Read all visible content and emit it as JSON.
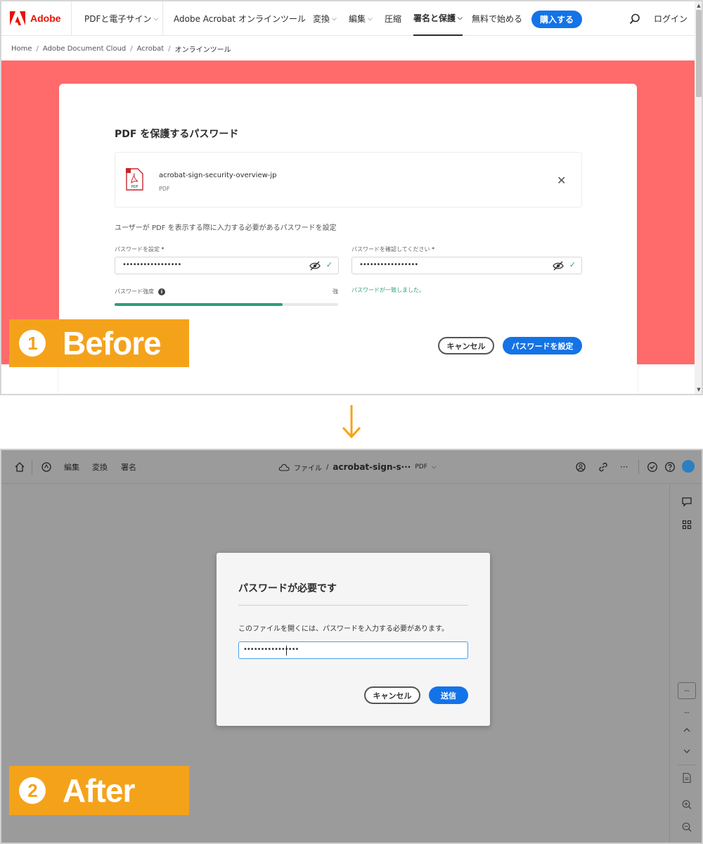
{
  "before": {
    "brand": {
      "name": "Adobe",
      "color": "#eb1000"
    },
    "nav": {
      "items": [
        "PDFと電子サイン",
        "Adobe Acrobat",
        "オンラインツール",
        "変換",
        "編集",
        "圧縮",
        "署名と保護",
        "無料で始める"
      ],
      "active_item": "署名と保護",
      "buy_label": "購入する",
      "login_label": "ログイン"
    },
    "breadcrumbs": [
      "Home",
      "Adobe Document Cloud",
      "Acrobat",
      "オンラインツール"
    ],
    "hero_color": "#ff6b6b",
    "card": {
      "title": "PDF を保護するパスワード",
      "file": {
        "name": "acrobat-sign-security-overview-jp",
        "type": "PDF",
        "icon_text": "PDF"
      },
      "description": "ユーザーが PDF を表示する際に入力する必要があるパスワードを設定",
      "password_label": "パスワードを設定",
      "confirm_label": "パスワードを確認してください",
      "required_mark": "*",
      "password_value": "•••••••••••••••••",
      "confirm_value": "•••••••••••••••••",
      "strength_label": "パスワード強度",
      "strength_value": "強",
      "strength_percent": 75,
      "match_message": "パスワードが一致しました。",
      "cancel_label": "キャンセル",
      "submit_label": "パスワードを設定"
    },
    "step": {
      "number": "1",
      "label": "Before"
    }
  },
  "after": {
    "toolbar": {
      "menu": [
        "編集",
        "変換",
        "署名"
      ],
      "crumb_prefix": "ファイル",
      "crumb_sep": "/",
      "file_name": "acrobat-sign-s···",
      "file_type": "PDF",
      "more": "···"
    },
    "rail": {
      "page_box": "--",
      "page_total": "--"
    },
    "dialog": {
      "title": "パスワードが必要です",
      "message": "このファイルを開くには、パスワードを入力する必要があります。",
      "input_value": "••••••••••••••••",
      "cancel_label": "キャンセル",
      "submit_label": "送信"
    },
    "step": {
      "number": "2",
      "label": "After"
    }
  },
  "colors": {
    "accent": "#1473e6",
    "success": "#2d9d78",
    "step_badge": "#f5a21b"
  }
}
